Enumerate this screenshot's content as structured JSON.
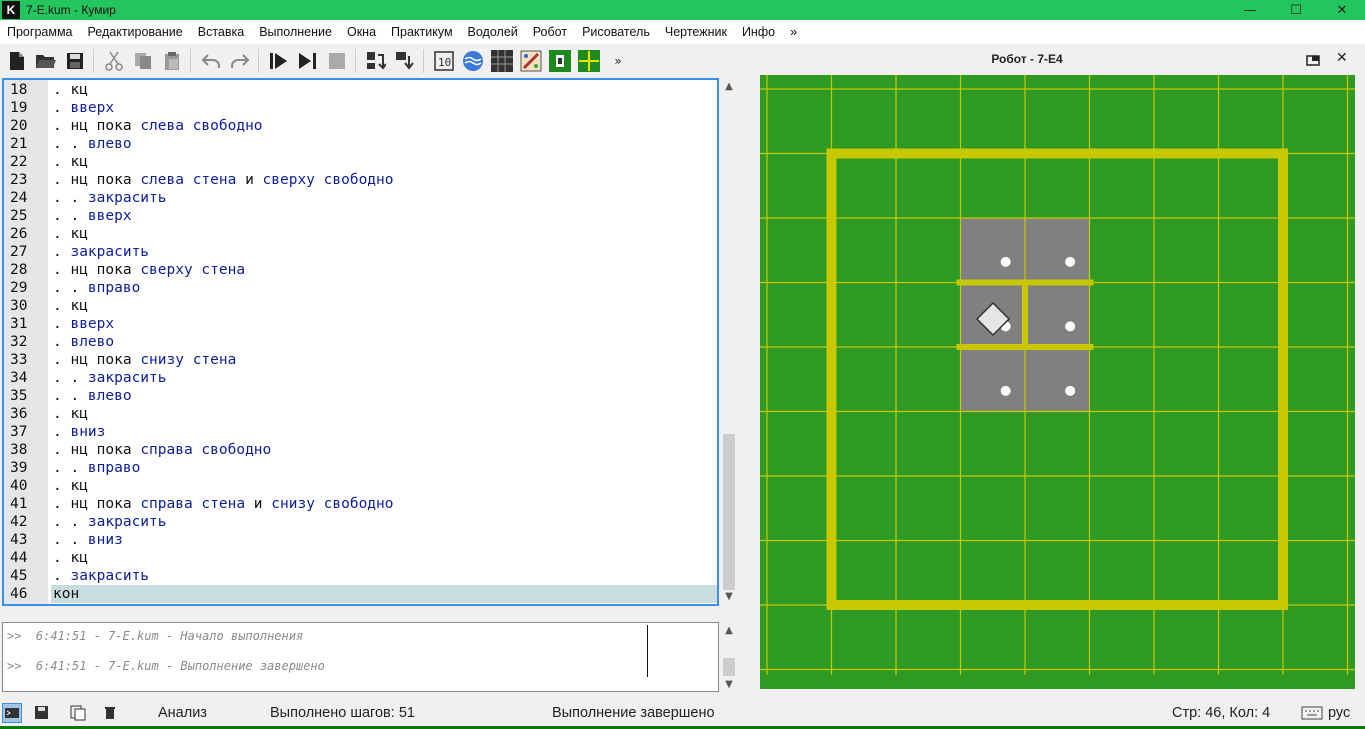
{
  "window": {
    "icon_letter": "K",
    "title": "7-E.kum - Кумир",
    "controls": [
      "—",
      "☐",
      "✕"
    ]
  },
  "menu": [
    "Программа",
    "Редактирование",
    "Вставка",
    "Выполнение",
    "Окна",
    "Практикум",
    "Водолей",
    "Робот",
    "Рисователь",
    "Чертежник",
    "Инфо",
    "»"
  ],
  "toolbar": {
    "icons": [
      "new-file-icon",
      "open-file-icon",
      "save-icon",
      "cut-icon",
      "copy-icon",
      "paste-icon",
      "undo-icon",
      "redo-icon",
      "run-icon",
      "step-icon",
      "stop-icon",
      "step-into-icon",
      "step-out-icon",
      "calculator-icon",
      "water-icon",
      "grid-icon",
      "painter-icon",
      "robot-icon",
      "drafter-icon"
    ],
    "more_label": "»"
  },
  "editor": {
    "lines": [
      {
        "n": "18",
        "parts": [
          {
            "t": ". ",
            "c": "kw"
          },
          {
            "t": "кц",
            "c": "kw"
          }
        ]
      },
      {
        "n": "19",
        "parts": [
          {
            "t": ". ",
            "c": "kw"
          },
          {
            "t": "вверх",
            "c": "id"
          }
        ]
      },
      {
        "n": "20",
        "parts": [
          {
            "t": ". ",
            "c": "kw"
          },
          {
            "t": "нц пока ",
            "c": "kw"
          },
          {
            "t": "слева свободно",
            "c": "id"
          }
        ]
      },
      {
        "n": "21",
        "parts": [
          {
            "t": ". . ",
            "c": "kw"
          },
          {
            "t": "влево",
            "c": "id"
          }
        ]
      },
      {
        "n": "22",
        "parts": [
          {
            "t": ". ",
            "c": "kw"
          },
          {
            "t": "кц",
            "c": "kw"
          }
        ]
      },
      {
        "n": "23",
        "parts": [
          {
            "t": ". ",
            "c": "kw"
          },
          {
            "t": "нц пока ",
            "c": "kw"
          },
          {
            "t": "слева стена",
            "c": "id"
          },
          {
            "t": " и ",
            "c": "kw"
          },
          {
            "t": "сверху свободно",
            "c": "id"
          }
        ]
      },
      {
        "n": "24",
        "parts": [
          {
            "t": ". . ",
            "c": "kw"
          },
          {
            "t": "закрасить",
            "c": "id"
          }
        ]
      },
      {
        "n": "25",
        "parts": [
          {
            "t": ". . ",
            "c": "kw"
          },
          {
            "t": "вверх",
            "c": "id"
          }
        ]
      },
      {
        "n": "26",
        "parts": [
          {
            "t": ". ",
            "c": "kw"
          },
          {
            "t": "кц",
            "c": "kw"
          }
        ]
      },
      {
        "n": "27",
        "parts": [
          {
            "t": ". ",
            "c": "kw"
          },
          {
            "t": "закрасить",
            "c": "id"
          }
        ]
      },
      {
        "n": "28",
        "parts": [
          {
            "t": ". ",
            "c": "kw"
          },
          {
            "t": "нц пока ",
            "c": "kw"
          },
          {
            "t": "сверху стена",
            "c": "id"
          }
        ]
      },
      {
        "n": "29",
        "parts": [
          {
            "t": ". . ",
            "c": "kw"
          },
          {
            "t": "вправо",
            "c": "id"
          }
        ]
      },
      {
        "n": "30",
        "parts": [
          {
            "t": ". ",
            "c": "kw"
          },
          {
            "t": "кц",
            "c": "kw"
          }
        ]
      },
      {
        "n": "31",
        "parts": [
          {
            "t": ". ",
            "c": "kw"
          },
          {
            "t": "вверх",
            "c": "id"
          }
        ]
      },
      {
        "n": "32",
        "parts": [
          {
            "t": ". ",
            "c": "kw"
          },
          {
            "t": "влево",
            "c": "id"
          }
        ]
      },
      {
        "n": "33",
        "parts": [
          {
            "t": ". ",
            "c": "kw"
          },
          {
            "t": "нц пока ",
            "c": "kw"
          },
          {
            "t": "снизу стена",
            "c": "id"
          }
        ]
      },
      {
        "n": "34",
        "parts": [
          {
            "t": ". . ",
            "c": "kw"
          },
          {
            "t": "закрасить",
            "c": "id"
          }
        ]
      },
      {
        "n": "35",
        "parts": [
          {
            "t": ". . ",
            "c": "kw"
          },
          {
            "t": "влево",
            "c": "id"
          }
        ]
      },
      {
        "n": "36",
        "parts": [
          {
            "t": ". ",
            "c": "kw"
          },
          {
            "t": "кц",
            "c": "kw"
          }
        ]
      },
      {
        "n": "37",
        "parts": [
          {
            "t": ". ",
            "c": "kw"
          },
          {
            "t": "вниз",
            "c": "id"
          }
        ]
      },
      {
        "n": "38",
        "parts": [
          {
            "t": ". ",
            "c": "kw"
          },
          {
            "t": "нц пока ",
            "c": "kw"
          },
          {
            "t": "справа свободно",
            "c": "id"
          }
        ]
      },
      {
        "n": "39",
        "parts": [
          {
            "t": ". . ",
            "c": "kw"
          },
          {
            "t": "вправо",
            "c": "id"
          }
        ]
      },
      {
        "n": "40",
        "parts": [
          {
            "t": ". ",
            "c": "kw"
          },
          {
            "t": "кц",
            "c": "kw"
          }
        ]
      },
      {
        "n": "41",
        "parts": [
          {
            "t": ". ",
            "c": "kw"
          },
          {
            "t": "нц пока ",
            "c": "kw"
          },
          {
            "t": "справа стена",
            "c": "id"
          },
          {
            "t": " и ",
            "c": "kw"
          },
          {
            "t": "снизу свободно",
            "c": "id"
          }
        ]
      },
      {
        "n": "42",
        "parts": [
          {
            "t": ". . ",
            "c": "kw"
          },
          {
            "t": "закрасить",
            "c": "id"
          }
        ]
      },
      {
        "n": "43",
        "parts": [
          {
            "t": ". . ",
            "c": "kw"
          },
          {
            "t": "вниз",
            "c": "id"
          }
        ]
      },
      {
        "n": "44",
        "parts": [
          {
            "t": ". ",
            "c": "kw"
          },
          {
            "t": "кц",
            "c": "kw"
          }
        ]
      },
      {
        "n": "45",
        "parts": [
          {
            "t": ". ",
            "c": "kw"
          },
          {
            "t": "закрасить",
            "c": "id"
          }
        ]
      },
      {
        "n": "46",
        "parts": [
          {
            "t": "кон",
            "c": "kw"
          }
        ],
        "current": true
      }
    ]
  },
  "console": {
    "lines": [
      ">>  6:41:51 - 7-E.kum - Начало выполнения",
      ">>  6:41:51 - 7-E.kum - Выполнение завершено"
    ]
  },
  "robot": {
    "title": "Робот  - 7-E4",
    "field_color": "#2e9a23",
    "wall_color": "#c8c800",
    "painted_color": "#808080"
  },
  "status": {
    "analysis": "Анализ",
    "steps": "Выполнено шагов: 51",
    "state": "Выполнение завершено",
    "cursor": "Стр: 46, Кол: 4",
    "lang": "рус"
  }
}
